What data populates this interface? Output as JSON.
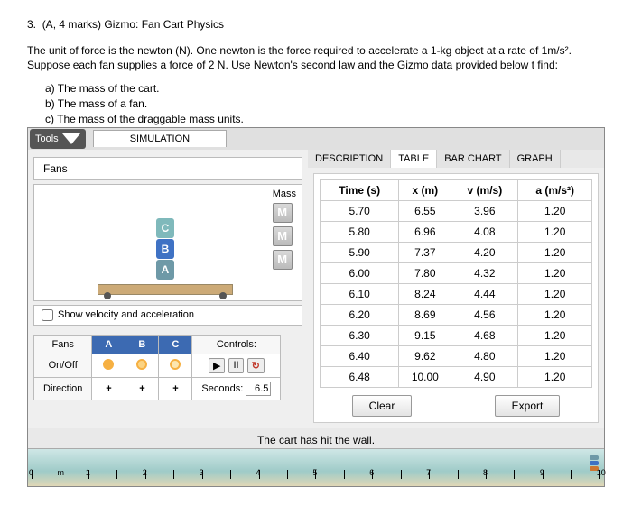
{
  "question": {
    "number": "3.",
    "meta": "(A, 4 marks) Gizmo: Fan Cart Physics",
    "intro": "The unit of force is the newton (N). One newton is the force required to accelerate a 1-kg object at a rate of 1m/s². Suppose each fan supplies a force of 2 N. Use Newton's second law and the Gizmo data provided below t find:",
    "a": "a)   The mass of the cart.",
    "b": "b)   The mass of a fan.",
    "c": "c)   The mass of the draggable mass units."
  },
  "toolbar": {
    "tools": "Tools",
    "simulation": "SIMULATION"
  },
  "left": {
    "fans_label": "Fans",
    "mass_label": "Mass",
    "mass_glyph": "M",
    "fanA": "A",
    "fanB": "B",
    "fanC": "C",
    "checkbox": "Show velocity and acceleration",
    "row_fans": "Fans",
    "row_onoff": "On/Off",
    "row_dir": "Direction",
    "controls": "Controls:",
    "seconds": "Seconds:",
    "seconds_val": "6.5",
    "plus": "+"
  },
  "tabs": {
    "desc": "DESCRIPTION",
    "table": "TABLE",
    "bar": "BAR CHART",
    "graph": "GRAPH"
  },
  "table": {
    "h_time": "Time (s)",
    "h_x": "x (m)",
    "h_v": "v (m/s)",
    "h_a": "a (m/s²)"
  },
  "chart_data": {
    "type": "table",
    "columns": [
      "Time (s)",
      "x (m)",
      "v (m/s)",
      "a (m/s²)"
    ],
    "rows": [
      [
        "5.70",
        "6.55",
        "3.96",
        "1.20"
      ],
      [
        "5.80",
        "6.96",
        "4.08",
        "1.20"
      ],
      [
        "5.90",
        "7.37",
        "4.20",
        "1.20"
      ],
      [
        "6.00",
        "7.80",
        "4.32",
        "1.20"
      ],
      [
        "6.10",
        "8.24",
        "4.44",
        "1.20"
      ],
      [
        "6.20",
        "8.69",
        "4.56",
        "1.20"
      ],
      [
        "6.30",
        "9.15",
        "4.68",
        "1.20"
      ],
      [
        "6.40",
        "9.62",
        "4.80",
        "1.20"
      ],
      [
        "6.48",
        "10.00",
        "4.90",
        "1.20"
      ]
    ]
  },
  "buttons": {
    "clear": "Clear",
    "export": "Export"
  },
  "hitmsg": "The cart has hit the wall.",
  "ruler": {
    "ticks": [
      "0",
      "m",
      "1",
      "",
      "2",
      "",
      "3",
      "",
      "4",
      "",
      "5",
      "",
      "6",
      "",
      "7",
      "",
      "8",
      "",
      "9",
      "",
      "10"
    ]
  }
}
